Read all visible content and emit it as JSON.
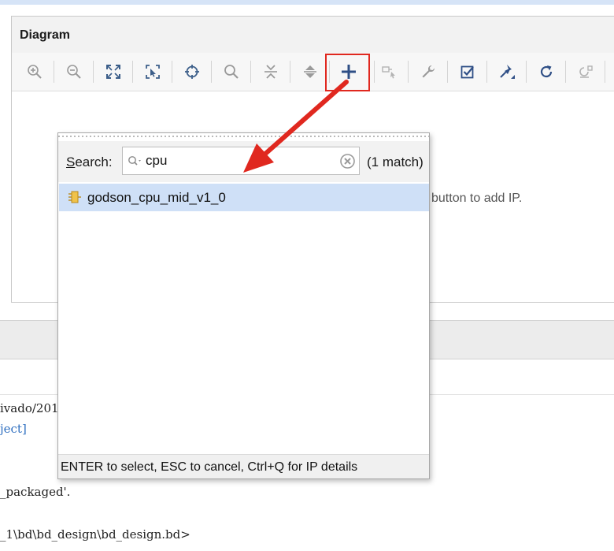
{
  "diagram": {
    "title": "Diagram",
    "canvas_hint": "button to add IP."
  },
  "toolbar": {
    "items": [
      {
        "icon": "zoom-in-icon"
      },
      {
        "icon": "zoom-out-icon"
      },
      {
        "icon": "zoom-fit-icon"
      },
      {
        "icon": "zoom-selection-icon"
      },
      {
        "icon": "center-target-icon"
      },
      {
        "icon": "search-icon"
      },
      {
        "icon": "collapse-all-icon"
      },
      {
        "icon": "expand-all-icon"
      },
      {
        "icon": "add-ip-icon"
      },
      {
        "icon": "make-external-icon"
      },
      {
        "icon": "wrench-icon"
      },
      {
        "icon": "validate-design-icon"
      },
      {
        "icon": "pin-icon"
      },
      {
        "icon": "refresh-icon"
      },
      {
        "icon": "regenerate-layout-icon"
      }
    ],
    "highlight_color": "#e0281f"
  },
  "console": {
    "lines": [
      {
        "text": "ivado/201"
      },
      {
        "text": "ject]"
      },
      {
        "text": "_packaged'."
      },
      {
        "text": "_1\\bd\\bd_design\\bd_design.bd>"
      }
    ]
  },
  "ip_search": {
    "label_prefix": "S",
    "label_rest": "earch:",
    "query": "cpu",
    "match_count": "(1 match)",
    "results": [
      {
        "name": "godson_cpu_mid_v1_0",
        "icon": "ip-block-icon"
      }
    ],
    "footer": "ENTER to select, ESC to cancel, Ctrl+Q for IP details"
  },
  "colors": {
    "selection": "#cfe0f7",
    "arrow": "#e0281f",
    "accent": "#2f6fc0"
  }
}
